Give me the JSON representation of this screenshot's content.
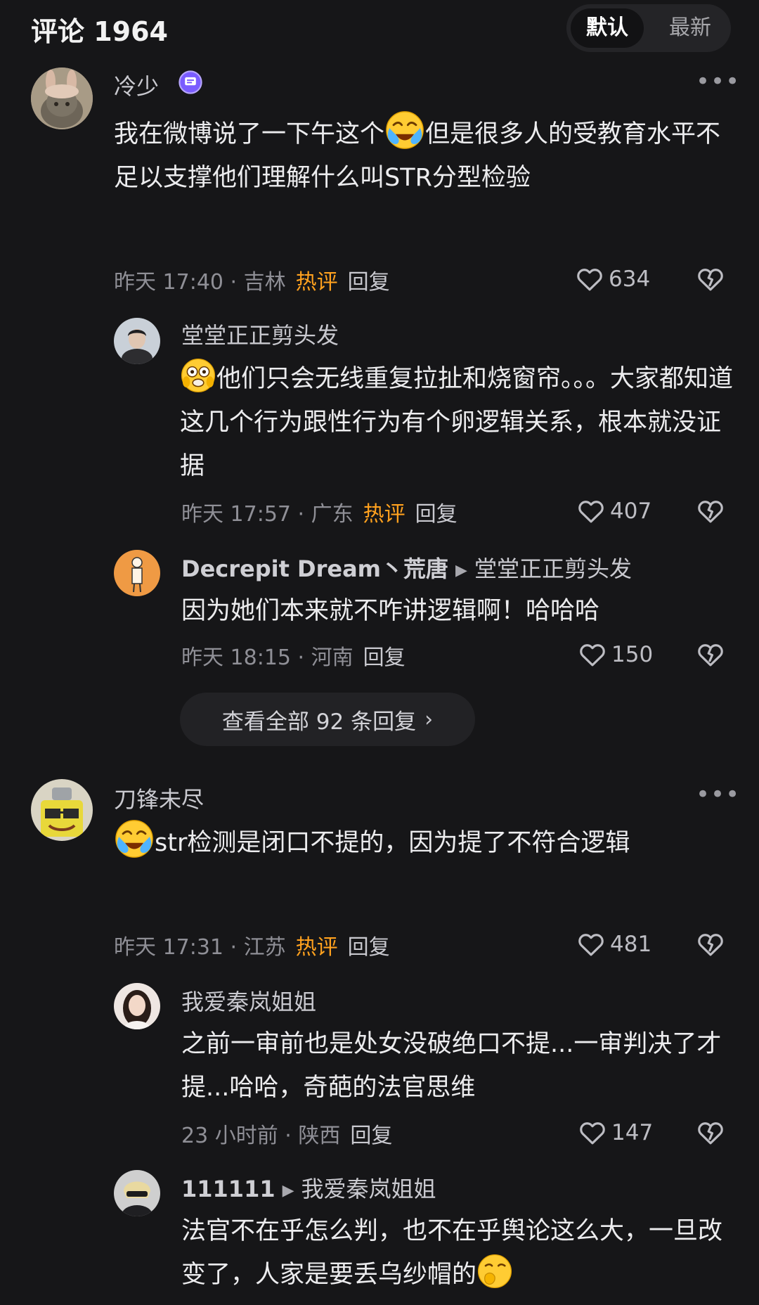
{
  "header": {
    "title": "评论 1964",
    "tabs": [
      "默认",
      "最新"
    ]
  },
  "comments": [
    {
      "user": "冷少",
      "text_a": "我在微博说了一下午这个",
      "text_b": "但是很多人的受教育水平不足以支撑他们理解什么叫STR分型检验",
      "time": "昨天 17:40",
      "location": "吉林",
      "hot": "热评",
      "reply": "回复",
      "likes": "634"
    },
    {
      "user": "堂堂正正剪头发",
      "text": "他们只会无线重复拉扯和烧窗帘。。。大家都知道这几个行为跟性行为有个卵逻辑关系，根本就没证据",
      "time": "昨天 17:57",
      "location": "广东",
      "hot": "热评",
      "reply": "回复",
      "likes": "407"
    },
    {
      "user": "Decrepit Dream丶荒唐",
      "reply_to": "堂堂正正剪头发",
      "text": "因为她们本来就不咋讲逻辑啊！哈哈哈",
      "time": "昨天 18:15",
      "location": "河南",
      "reply": "回复",
      "likes": "150"
    },
    {
      "user": "刀锋未尽",
      "text": "str检测是闭口不提的，因为提了不符合逻辑",
      "time": "昨天 17:31",
      "location": "江苏",
      "hot": "热评",
      "reply": "回复",
      "likes": "481"
    },
    {
      "user": "我爱秦岚姐姐",
      "text": "之前一审前也是处女没破绝口不提...一审判决了才提...哈哈，奇葩的法官思维",
      "time": "23 小时前",
      "location": "陕西",
      "reply": "回复",
      "likes": "147"
    },
    {
      "user": "111111",
      "reply_to": "我爱秦岚姐姐",
      "text": "法官不在乎怎么判，也不在乎舆论这么大，一旦改变了，人家是要丢乌纱帽的"
    }
  ],
  "view_all_replies": "查看全部 92 条回复",
  "colors": {
    "background": "#161618",
    "hot": "#ffa11e",
    "meta": "#8f8f96"
  }
}
